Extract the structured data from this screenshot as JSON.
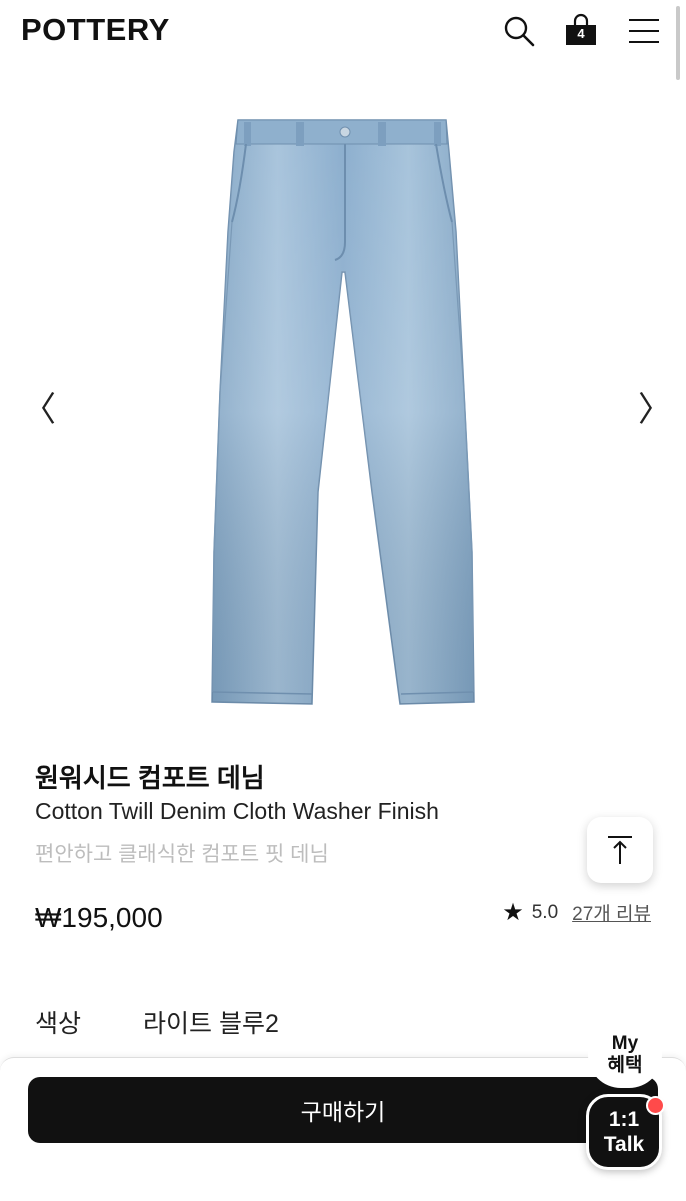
{
  "header": {
    "logo": "POTTERY",
    "cart_count": "4",
    "icons": [
      "search-icon",
      "shopping-bag-icon",
      "menu-icon"
    ]
  },
  "gallery": {
    "prev_arrow": "〈",
    "next_arrow": "〉",
    "image": "light-blue-denim-jeans"
  },
  "product": {
    "title_ko": "원워시드 컴포트 데님",
    "title_en": "Cotton Twill Denim Cloth Washer Finish",
    "subtitle": "편안하고 클래식한 컴포트 핏 데님",
    "price": "₩195,000",
    "rating": "5.0",
    "reviews": "27개 리뷰"
  },
  "option": {
    "label": "색상",
    "value": "라이트 블루2"
  },
  "actions": {
    "buy": "구매하기",
    "my_benefit_line1": "My",
    "my_benefit_line2": "혜택",
    "talk_line1": "1:1",
    "talk_line2": "Talk"
  },
  "colors": {
    "denim": "#8fb3d0",
    "denim_dark": "#6f95b6",
    "primary": "#111111",
    "notification": "#ff4a4a"
  }
}
